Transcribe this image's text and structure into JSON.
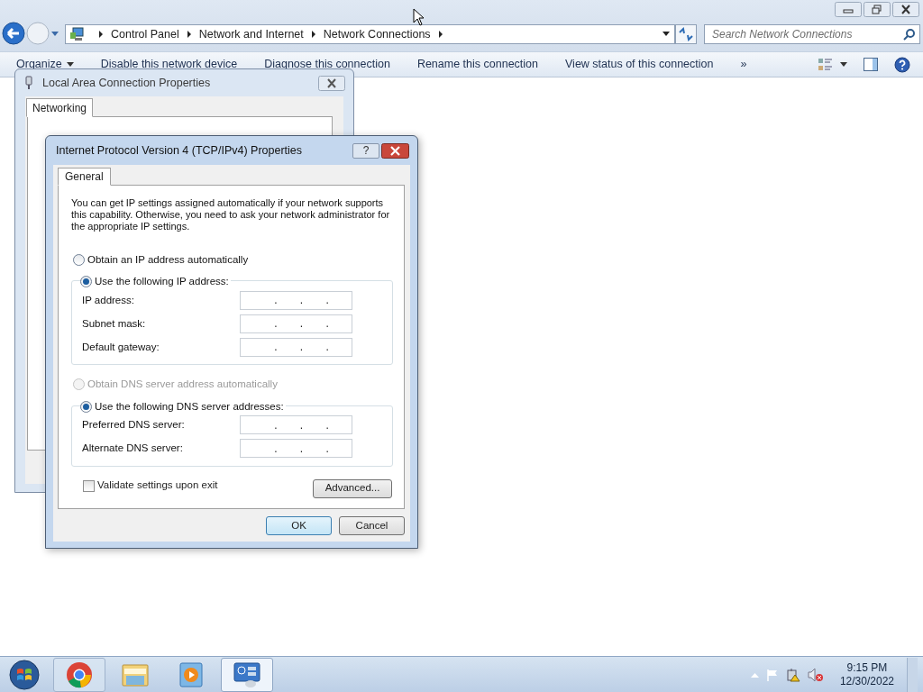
{
  "explorer": {
    "breadcrumb": [
      "Control Panel",
      "Network and Internet",
      "Network Connections"
    ],
    "search": {
      "placeholder": "Search Network Connections"
    },
    "toolbar": [
      {
        "label": "Organize",
        "kind": "menu"
      },
      {
        "label": "Disable this network device",
        "kind": "command"
      },
      {
        "label": "Diagnose this connection",
        "kind": "command"
      },
      {
        "label": "Rename this connection",
        "kind": "command"
      },
      {
        "label": "View status of this connection",
        "kind": "command"
      },
      {
        "label": "»",
        "kind": "overflow"
      }
    ]
  },
  "back_dialog": {
    "title": "Local Area Connection Properties",
    "tabs": [
      {
        "label": "Networking",
        "selected": true
      }
    ]
  },
  "ipv4_dialog": {
    "title": "Internet Protocol Version 4 (TCP/IPv4) Properties",
    "help": "?",
    "tabs": [
      {
        "label": "General",
        "selected": true
      }
    ],
    "intro": "You can get IP settings assigned automatically if your network supports this capability. Otherwise, you need to ask your network administrator for the appropriate IP settings.",
    "ip_options": [
      {
        "label": "Obtain an IP address automatically",
        "selected": false,
        "disabled": false
      },
      {
        "label": "Use the following IP address:",
        "selected": true,
        "disabled": false
      }
    ],
    "ip_fields": [
      {
        "label": "IP address:",
        "value": ". . ."
      },
      {
        "label": "Subnet mask:",
        "value": ". . ."
      },
      {
        "label": "Default gateway:",
        "value": ". . ."
      }
    ],
    "dns_options": [
      {
        "label": "Obtain DNS server address automatically",
        "selected": false,
        "disabled": true
      },
      {
        "label": "Use the following DNS server addresses:",
        "selected": true,
        "disabled": false
      }
    ],
    "dns_fields": [
      {
        "label": "Preferred DNS server:",
        "value": ". . ."
      },
      {
        "label": "Alternate DNS server:",
        "value": ". . ."
      }
    ],
    "validate": {
      "label": "Validate settings upon exit",
      "checked": false
    },
    "advanced": "Advanced...",
    "buttons": [
      {
        "label": "OK",
        "default": true
      },
      {
        "label": "Cancel",
        "default": false
      }
    ]
  },
  "taskbar": {
    "items": [
      {
        "kind": "browser",
        "selected": false
      },
      {
        "kind": "folder",
        "selected": false
      },
      {
        "kind": "media",
        "selected": false
      },
      {
        "kind": "control-panel",
        "selected": true
      }
    ],
    "time": "9:15 PM",
    "date": "12/30/2022"
  }
}
